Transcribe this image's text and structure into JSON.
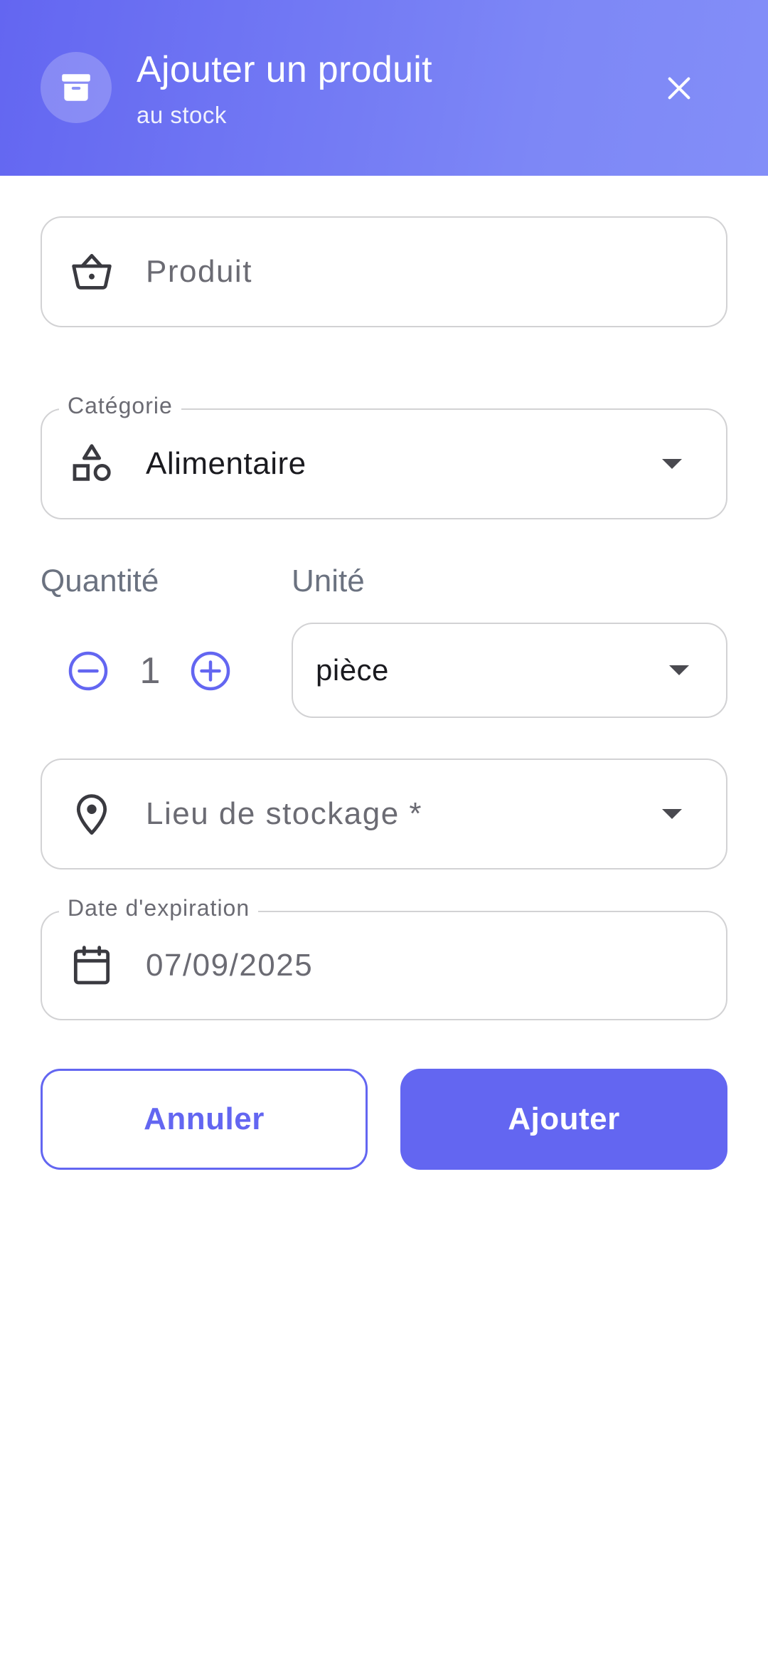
{
  "header": {
    "title": "Ajouter un produit",
    "subtitle": "au stock",
    "icon": "archive-box-icon",
    "close_icon": "close-icon",
    "gradient_start": "#6366f1",
    "gradient_end": "#838ef8"
  },
  "form": {
    "product": {
      "placeholder": "Produit",
      "icon": "basket-icon"
    },
    "category": {
      "label": "Catégorie",
      "value": "Alimentaire",
      "icon": "shapes-icon"
    },
    "quantity": {
      "label": "Quantité",
      "value": "1",
      "decrement_icon": "minus-circle-icon",
      "increment_icon": "plus-circle-icon"
    },
    "unit": {
      "label": "Unité",
      "value": "pièce"
    },
    "location": {
      "placeholder": "Lieu de stockage *",
      "icon": "map-pin-icon"
    },
    "expiration": {
      "label": "Date d'expiration",
      "value": "07/09/2025",
      "icon": "calendar-icon"
    }
  },
  "actions": {
    "cancel_label": "Annuler",
    "submit_label": "Ajouter"
  },
  "colors": {
    "accent": "#6366f1",
    "border": "#d2d2d4",
    "muted_text": "#6b6b73"
  }
}
